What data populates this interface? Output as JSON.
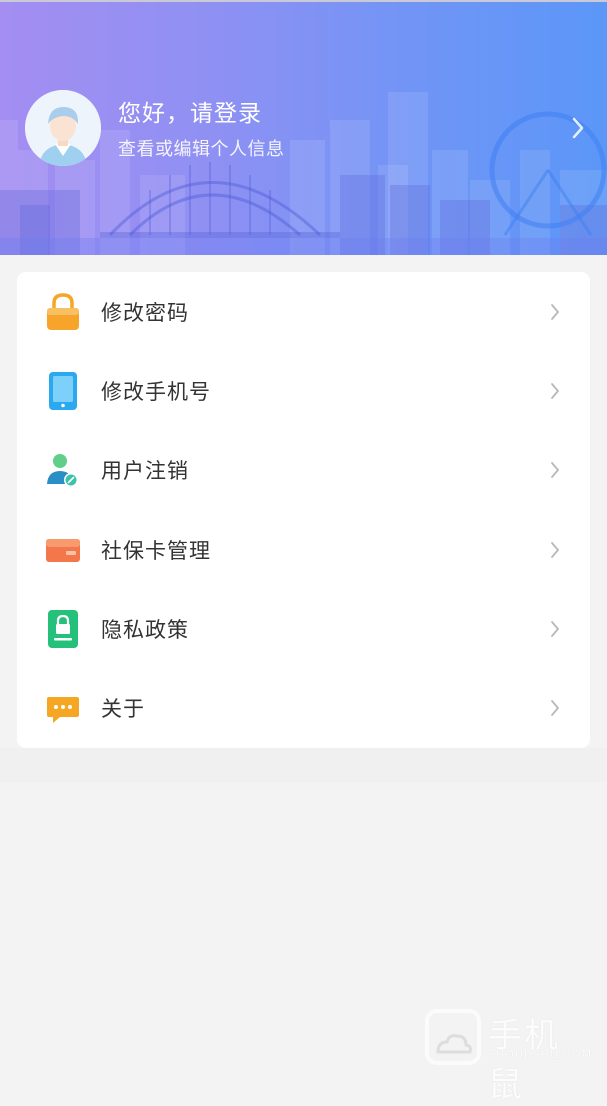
{
  "colors": {
    "header_gradient_start": "#a48ef2",
    "header_gradient_end": "#5b97f8",
    "page_background": "#f3f3f3",
    "card_background": "#ffffff",
    "label_text": "#333333",
    "chevron": "#b8b8b8"
  },
  "header": {
    "greeting": "您好，请登录",
    "subtitle": "查看或编辑个人信息",
    "avatar_icon": "user-avatar-icon",
    "arrow_icon": "chevron-right-icon"
  },
  "menu": {
    "items": [
      {
        "label": "修改密码",
        "icon": "lock-icon",
        "color": "#f5a623"
      },
      {
        "label": "修改手机号",
        "icon": "phone-icon",
        "color": "#2aa8f0"
      },
      {
        "label": "用户注销",
        "icon": "user-cancel-icon",
        "color": "#2bb59a"
      },
      {
        "label": "社保卡管理",
        "icon": "card-icon",
        "color": "#f4774b"
      },
      {
        "label": "隐私政策",
        "icon": "privacy-lock-icon",
        "color": "#25c07a"
      },
      {
        "label": "关于",
        "icon": "message-icon",
        "color": "#f5a623"
      }
    ]
  },
  "watermark": {
    "text": "手机鼠",
    "subtext": "SHOUJISHU.COM"
  }
}
